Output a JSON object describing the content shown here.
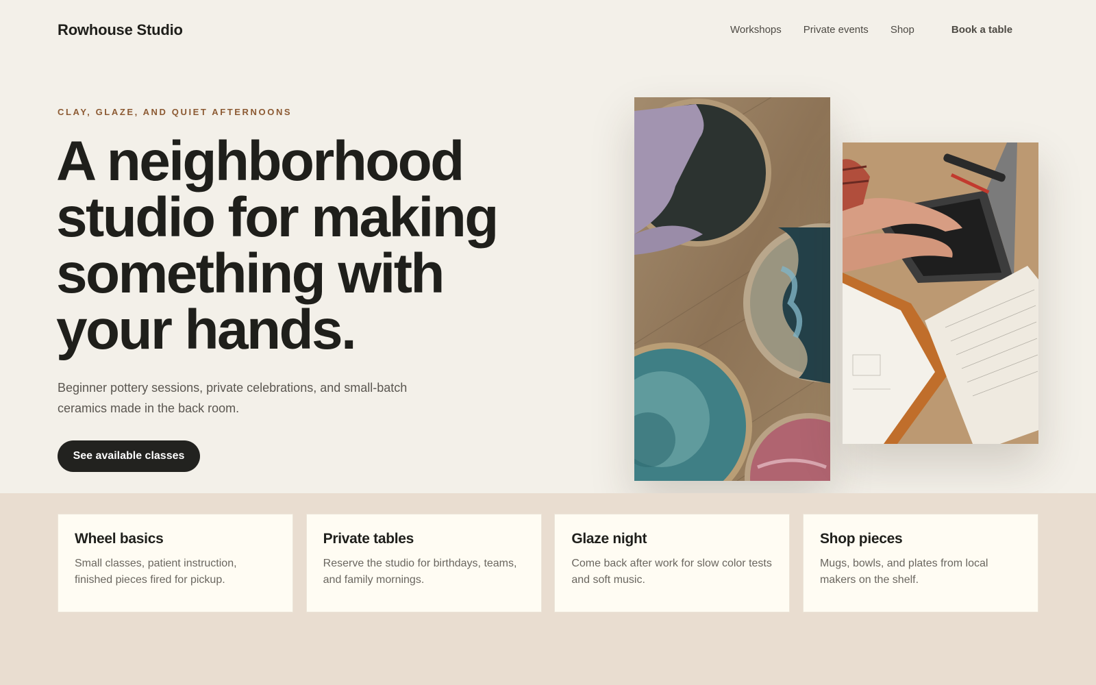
{
  "header": {
    "brand": "Rowhouse Studio",
    "nav": [
      "Workshops",
      "Private events",
      "Shop"
    ],
    "book_label": "Book a table"
  },
  "hero": {
    "eyebrow": "CLAY, GLAZE, AND QUIET AFTERNOONS",
    "headline": "A neighborhood studio for making something with your hands.",
    "lede": "Beginner pottery sessions, private celebrations, and small-batch ceramics made in the back room.",
    "cta_label": "See available classes"
  },
  "cards": [
    {
      "title": "Wheel basics",
      "text": "Small classes, patient instruction, finished pieces fired for pickup."
    },
    {
      "title": "Private tables",
      "text": "Reserve the studio for birthdays, teams, and family mornings."
    },
    {
      "title": "Glaze night",
      "text": "Come back after work for slow color tests and soft music."
    },
    {
      "title": "Shop pieces",
      "text": "Mugs, bowls, and plates from local makers on the shelf."
    }
  ],
  "colors": {
    "page_bg": "#f3f0e9",
    "band_bg": "#e9ddd0",
    "card_bg": "#fffcf3",
    "accent": "#8c5a33",
    "ink": "#1f1f1b"
  }
}
